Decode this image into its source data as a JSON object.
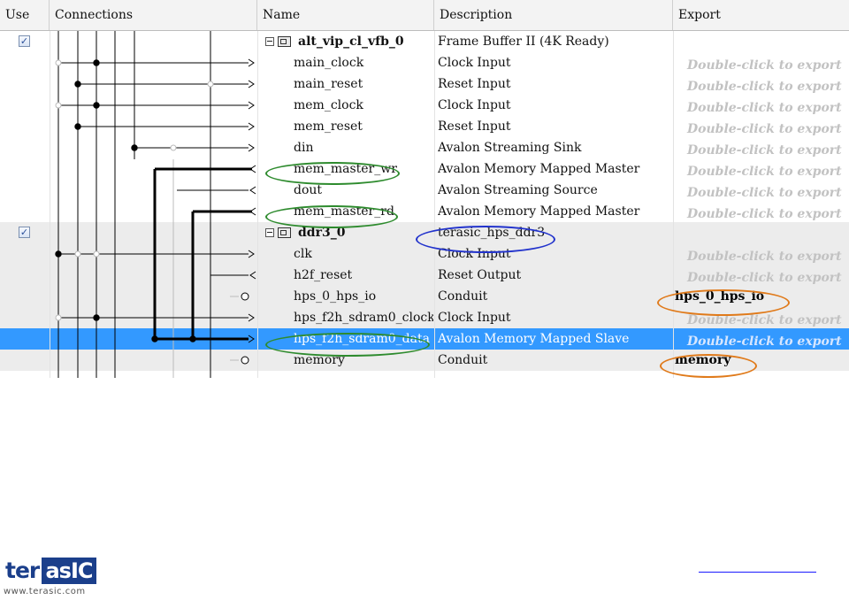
{
  "header": {
    "use": "Use",
    "connections": "Connections",
    "name": "Name",
    "description": "Description",
    "export": "Export"
  },
  "export_hint": "Double-click to export",
  "export_hint_partial_top": "Double-click to export",
  "rows": [
    {
      "name": "alt_vip_cl_vfb_0",
      "desc": "Frame Buffer II (4K Ready)",
      "export": ""
    },
    {
      "name": "main_clock",
      "desc": "Clock Input",
      "export": "Double-click to export"
    },
    {
      "name": "main_reset",
      "desc": "Reset Input",
      "export": "Double-click to export"
    },
    {
      "name": "mem_clock",
      "desc": "Clock Input",
      "export": "Double-click to export"
    },
    {
      "name": "mem_reset",
      "desc": "Reset Input",
      "export": "Double-click to export"
    },
    {
      "name": "din",
      "desc": "Avalon Streaming Sink",
      "export": "Double-click to export"
    },
    {
      "name": "mem_master_wr",
      "desc": "Avalon Memory Mapped Master",
      "export": "Double-click to export"
    },
    {
      "name": "dout",
      "desc": "Avalon Streaming Source",
      "export": "Double-click to export"
    },
    {
      "name": "mem_master_rd",
      "desc": "Avalon Memory Mapped Master",
      "export": "Double-click to export"
    },
    {
      "name": "ddr3_0",
      "desc": "terasic_hps_ddr3",
      "export": ""
    },
    {
      "name": "clk",
      "desc": "Clock Input",
      "export": "Double-click to export"
    },
    {
      "name": "h2f_reset",
      "desc": "Reset Output",
      "export": "Double-click to export"
    },
    {
      "name": "hps_0_hps_io",
      "desc": "Conduit",
      "export": "hps_0_hps_io"
    },
    {
      "name": "hps_f2h_sdram0_clock",
      "desc": "Clock Input",
      "export": "Double-click to export"
    },
    {
      "name": "hps_f2h_sdram0_data",
      "desc": "Avalon Memory Mapped Slave",
      "export": "Double-click to export"
    },
    {
      "name": "memory",
      "desc": "Conduit",
      "export": "memory"
    }
  ],
  "logo": {
    "ter": "ter",
    "asic": "asIC",
    "url": "www.terasic.com"
  },
  "colors": {
    "selection": "#3399ff",
    "green_highlight": "#2e8b2e",
    "blue_highlight": "#2233cc",
    "orange_highlight": "#e07a1a"
  }
}
